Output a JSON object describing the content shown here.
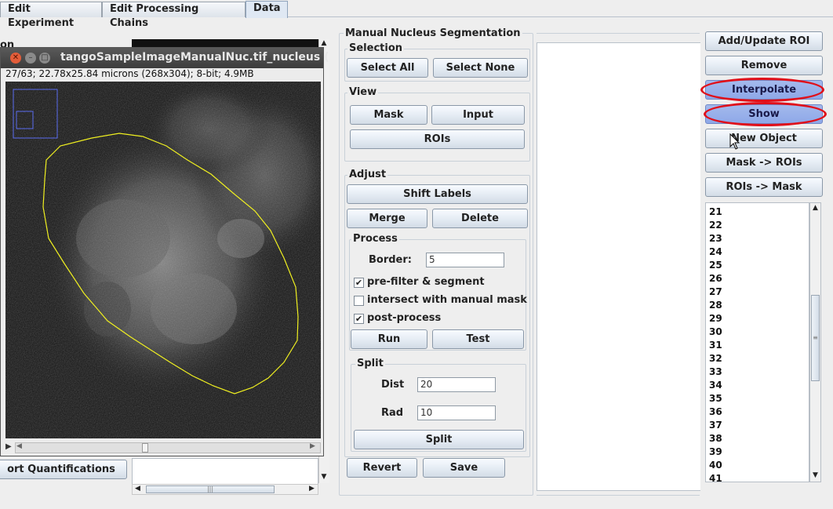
{
  "tabs": [
    {
      "label": "Edit Experiment",
      "active": false
    },
    {
      "label": "Edit Processing Chains",
      "active": false
    },
    {
      "label": "Data",
      "active": true
    }
  ],
  "left_panel": {
    "partial_label": "on",
    "export_button": "ort Quantifications"
  },
  "image_window": {
    "title": "tangoSampleImageManualNuc.tif_nucleus (",
    "info": "27/63; 22.78x25.84 microns (268x304); 8-bit; 4.9MB"
  },
  "segmentation": {
    "title": "Manual Nucleus Segmentation",
    "selection": {
      "label": "Selection",
      "select_all": "Select All",
      "select_none": "Select None"
    },
    "view": {
      "label": "View",
      "mask": "Mask",
      "input": "Input",
      "rois": "ROIs"
    },
    "adjust": {
      "label": "Adjust",
      "shift_labels": "Shift Labels",
      "merge": "Merge",
      "delete": "Delete",
      "process": {
        "label": "Process",
        "border_label": "Border:",
        "border_value": "5",
        "prefilter": {
          "label": "pre-filter & segment",
          "checked": true
        },
        "intersect": {
          "label": "intersect with manual mask",
          "checked": false
        },
        "postprocess": {
          "label": "post-process",
          "checked": true
        },
        "run": "Run",
        "test": "Test"
      },
      "split": {
        "label": "Split",
        "dist_label": "Dist",
        "dist_value": "20",
        "rad_label": "Rad",
        "rad_value": "10",
        "split_button": "Split"
      }
    },
    "revert": "Revert",
    "save": "Save"
  },
  "roi_buttons": {
    "add_update": "Add/Update ROI",
    "remove": "Remove",
    "interpolate": "Interpolate",
    "show": "Show",
    "new_object": "New Object",
    "mask_to_rois": "Mask -> ROIs",
    "rois_to_mask": "ROIs -> Mask"
  },
  "roi_list": [
    "21",
    "22",
    "23",
    "24",
    "25",
    "26",
    "27",
    "28",
    "29",
    "30",
    "31",
    "32",
    "33",
    "34",
    "35",
    "36",
    "37",
    "38",
    "39",
    "40",
    "41"
  ],
  "colors": {
    "highlight_ring": "#e0101a",
    "selected_button": "#8ea8e8",
    "roi_outline": "#f0f020",
    "roi_box": "#5a6cf0"
  },
  "icons": {
    "close": "close-icon",
    "minimize": "minimize-icon",
    "maximize": "maximize-icon",
    "cursor": "mouse-pointer-icon"
  }
}
